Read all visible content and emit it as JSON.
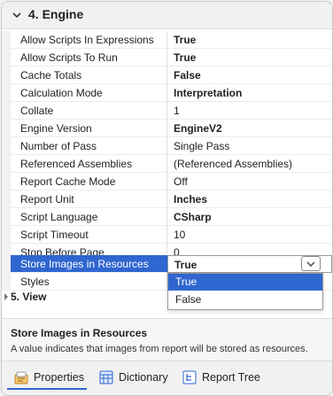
{
  "category": {
    "title": "4. Engine"
  },
  "properties": [
    {
      "name": "Allow Scripts In Expressions",
      "value": "True",
      "bold": true
    },
    {
      "name": "Allow Scripts To Run",
      "value": "True",
      "bold": true
    },
    {
      "name": "Cache Totals",
      "value": "False",
      "bold": true
    },
    {
      "name": "Calculation Mode",
      "value": "Interpretation",
      "bold": true
    },
    {
      "name": "Collate",
      "value": "1",
      "bold": false
    },
    {
      "name": "Engine Version",
      "value": "EngineV2",
      "bold": true
    },
    {
      "name": "Number of Pass",
      "value": "Single Pass",
      "bold": false
    },
    {
      "name": "Referenced Assemblies",
      "value": "(Referenced Assemblies)",
      "bold": false
    },
    {
      "name": "Report Cache Mode",
      "value": "Off",
      "bold": false
    },
    {
      "name": "Report Unit",
      "value": "Inches",
      "bold": true
    },
    {
      "name": "Script Language",
      "value": "CSharp",
      "bold": true
    },
    {
      "name": "Script Timeout",
      "value": "10",
      "bold": false
    },
    {
      "name": "Stop Before Page",
      "value": "0",
      "bold": false
    },
    {
      "name": "Store Images in Resources",
      "value": "True",
      "bold": true,
      "selected": true
    },
    {
      "name": "Styles",
      "value": "",
      "bold": false
    }
  ],
  "next_section": {
    "title": "5. View"
  },
  "dropdown": {
    "options": [
      "True",
      "False"
    ],
    "highlighted": "True"
  },
  "description": {
    "title": "Store Images in Resources",
    "text": "A value indicates that images from report will be stored as resources."
  },
  "tabs": [
    {
      "label": "Properties",
      "icon": "properties-icon",
      "active": true
    },
    {
      "label": "Dictionary",
      "icon": "dictionary-icon",
      "active": false
    },
    {
      "label": "Report Tree",
      "icon": "report-tree-icon",
      "active": false
    }
  ],
  "colors": {
    "accent": "#2f66d0"
  }
}
